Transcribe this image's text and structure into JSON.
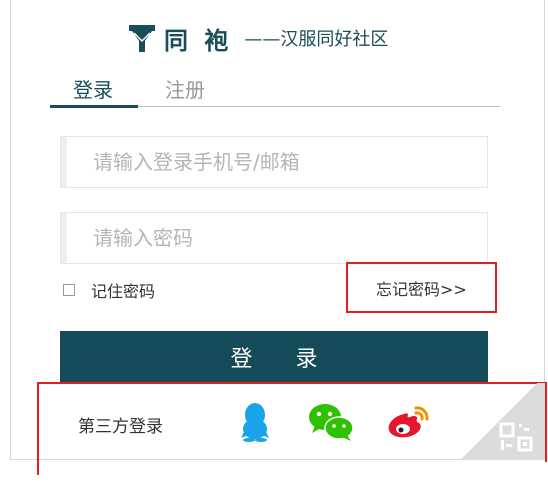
{
  "brand": {
    "name": "同 袍",
    "slogan": "——汉服同好社区",
    "color": "#1b4c5a"
  },
  "tabs": [
    {
      "label": "登录",
      "active": true
    },
    {
      "label": "注册",
      "active": false
    }
  ],
  "form": {
    "phone_placeholder": "请输入登录手机号/邮箱",
    "password_placeholder": "请输入密码",
    "remember_label": "记住密码",
    "remember_checked": false,
    "forgot_label": "忘记密码>>",
    "login_label": "登 录",
    "button_color": "#154a58"
  },
  "third_party": {
    "label": "第三方登录",
    "providers": [
      {
        "icon": "qq-icon",
        "color": "#1aa3e8"
      },
      {
        "icon": "wechat-icon",
        "color": "#2dc100"
      },
      {
        "icon": "weibo-icon",
        "color": "#e6162d"
      }
    ]
  },
  "annotations": {
    "highlight_color": "#e02020"
  },
  "qr_corner": {
    "icon": "qr-code-icon"
  }
}
